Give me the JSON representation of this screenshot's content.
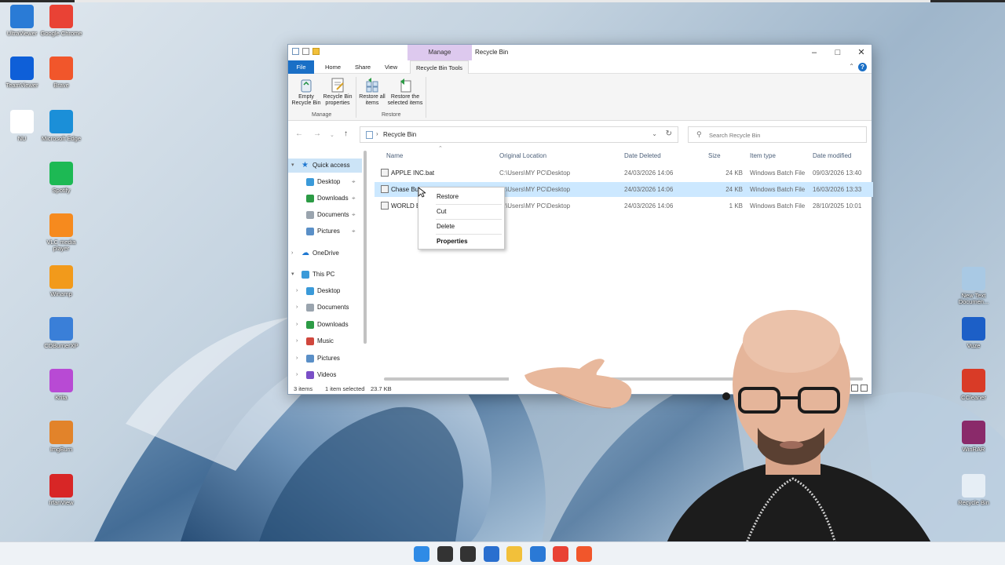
{
  "desktop_left": [
    {
      "label": "UltraViewer",
      "icon": "ultraviewer-icon",
      "color": "#2a7bd6"
    },
    {
      "label": "Google Chrome",
      "icon": "chrome-icon",
      "color": "#e94235"
    },
    {
      "label": "TeamViewer",
      "icon": "teamviewer-icon",
      "color": "#0e5fd8"
    },
    {
      "label": "Brave",
      "icon": "brave-icon",
      "color": "#f1562b"
    },
    {
      "label": "NU",
      "icon": "blank-file-icon",
      "color": "#ffffff"
    },
    {
      "label": "Microsoft Edge",
      "icon": "edge-icon",
      "color": "#1b8fd8"
    },
    {
      "label": "Spotify",
      "icon": "spotify-icon",
      "color": "#1db954"
    },
    {
      "label": "VLC media player",
      "icon": "vlc-icon",
      "color": "#f68a1e"
    },
    {
      "label": "Winamp",
      "icon": "winamp-icon",
      "color": "#f29a1b"
    },
    {
      "label": "CDBurnerXP",
      "icon": "cdburnerxp-icon",
      "color": "#3a7fd8"
    },
    {
      "label": "Krita",
      "icon": "krita-icon",
      "color": "#b84ad4"
    },
    {
      "label": "ImgBurn",
      "icon": "imgburn-icon",
      "color": "#e2832a"
    },
    {
      "label": "IrfanView",
      "icon": "irfanview-icon",
      "color": "#d82626"
    }
  ],
  "desktop_right": [
    {
      "label": "New Text Documen...",
      "icon": "text-document-icon",
      "color": "#a9c9e4"
    },
    {
      "label": "Vuze",
      "icon": "vuze-icon",
      "color": "#1c5fc7"
    },
    {
      "label": "CCleaner",
      "icon": "ccleaner-icon",
      "color": "#d93b27"
    },
    {
      "label": "WinRAR",
      "icon": "winrar-icon",
      "color": "#8a2a6a"
    },
    {
      "label": "Recycle Bin",
      "icon": "recycle-bin-icon",
      "color": "#e6eef5"
    }
  ],
  "window": {
    "title": "Recycle Bin",
    "context_tab": "Manage",
    "tabs": [
      "File",
      "Home",
      "Share",
      "View",
      "Recycle Bin Tools"
    ],
    "ribbon": {
      "buttons": [
        {
          "label": "Empty Recycle Bin",
          "icon": "empty-recycle-bin-icon"
        },
        {
          "label": "Recycle Bin properties",
          "icon": "properties-icon"
        },
        {
          "label": "Restore all items",
          "icon": "restore-all-icon"
        },
        {
          "label": "Restore the selected items",
          "icon": "restore-selected-icon"
        }
      ],
      "groups": [
        "Manage",
        "Restore"
      ]
    },
    "address": "Recycle Bin",
    "search_placeholder": "Search Recycle Bin",
    "nav": {
      "quick_access": "Quick access",
      "quick_items": [
        "Desktop",
        "Downloads",
        "Documents",
        "Pictures"
      ],
      "onedrive": "OneDrive",
      "this_pc": "This PC",
      "pc_items": [
        "Desktop",
        "Documents",
        "Downloads",
        "Music",
        "Pictures",
        "Videos"
      ]
    },
    "columns": [
      "Name",
      "Original Location",
      "Date Deleted",
      "Size",
      "Item type",
      "Date modified"
    ],
    "rows": [
      {
        "name": "APPLE INC.bat",
        "location": "C:\\Users\\MY PC\\Desktop",
        "deleted": "24/03/2026 14:06",
        "size": "24 KB",
        "type": "Windows Batch File",
        "modified": "09/03/2026 13:40"
      },
      {
        "name": "Chase Bus",
        "location": "C:\\Users\\MY PC\\Desktop",
        "deleted": "24/03/2026 14:06",
        "size": "24 KB",
        "type": "Windows Batch File",
        "modified": "16/03/2026 13:33"
      },
      {
        "name": "WORLD B",
        "location": "C:\\Users\\MY PC\\Desktop",
        "deleted": "24/03/2026 14:06",
        "size": "1 KB",
        "type": "Windows Batch File",
        "modified": "28/10/2025 10:01"
      }
    ],
    "status": {
      "count": "3 items",
      "selected": "1 item selected",
      "size": "23.7 KB"
    }
  },
  "context_menu": [
    "Restore",
    "Cut",
    "Delete",
    "Properties"
  ],
  "taskbar": [
    {
      "icon": "start-icon",
      "color": "#2f8be6"
    },
    {
      "icon": "search-icon",
      "color": "#333333"
    },
    {
      "icon": "task-view-icon",
      "color": "#333333"
    },
    {
      "icon": "widgets-icon",
      "color": "#2a6fcf"
    },
    {
      "icon": "file-explorer-icon",
      "color": "#f2c03a"
    },
    {
      "icon": "store-icon",
      "color": "#2a79d6"
    },
    {
      "icon": "chrome-icon",
      "color": "#e94235"
    },
    {
      "icon": "brave-icon",
      "color": "#f1562b"
    }
  ]
}
